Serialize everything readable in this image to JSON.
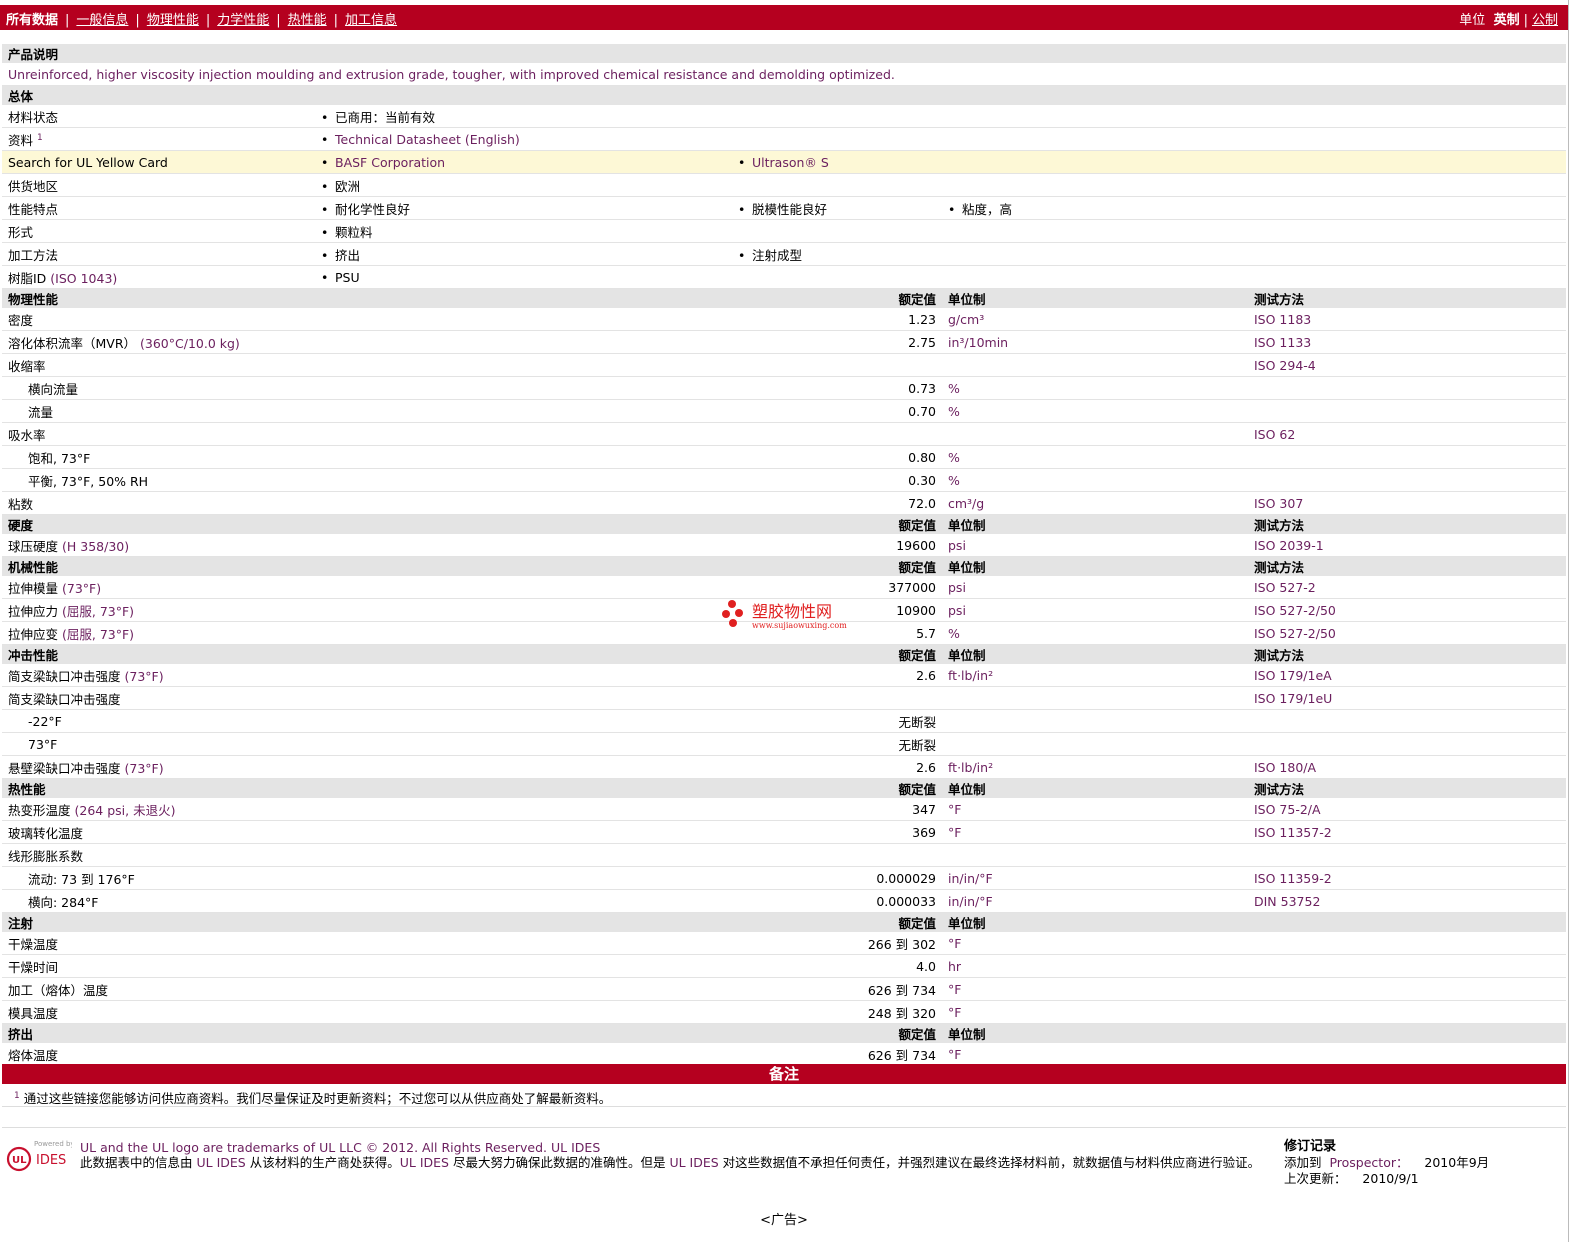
{
  "topbar": {
    "tabs": [
      {
        "label": "所有数据",
        "active": true
      },
      {
        "label": "一般信息"
      },
      {
        "label": "物理性能"
      },
      {
        "label": "力学性能"
      },
      {
        "label": "热性能"
      },
      {
        "label": "加工信息"
      }
    ],
    "units_label": "单位",
    "units_active": "英制",
    "units_other": "公制"
  },
  "description": {
    "title": "产品说明",
    "text": "Unreinforced, higher viscosity injection moulding and extrusion grade, tougher, with improved chemical resistance and demolding optimized."
  },
  "general": {
    "title": "总体",
    "rows": [
      {
        "label": "材料状态",
        "values": [
          "已商用：当前有效"
        ]
      },
      {
        "label": "资料",
        "sup": "1",
        "values": [
          "Technical Datasheet (English)"
        ],
        "link": true
      },
      {
        "label": "Search for UL Yellow Card",
        "values": [
          "BASF Corporation",
          "Ultrason® S"
        ],
        "link": true,
        "highlight": true
      },
      {
        "label": "供货地区",
        "values": [
          "欧洲"
        ]
      },
      {
        "label": "性能特点",
        "values": [
          "耐化学性良好",
          "脱模性能良好",
          "粘度，高"
        ]
      },
      {
        "label": "形式",
        "values": [
          "颗粒料"
        ]
      },
      {
        "label": "加工方法",
        "values": [
          "挤出",
          "注射成型"
        ]
      },
      {
        "label": "树脂ID",
        "label_extra": "(ISO 1043)",
        "values": [
          "PSU"
        ]
      }
    ]
  },
  "headers": {
    "value": "额定值",
    "unit": "单位制",
    "method": "测试方法"
  },
  "sections": [
    {
      "title": "物理性能",
      "show_method": true,
      "rows": [
        {
          "label": "密度",
          "value": "1.23",
          "unit": "g/cm³",
          "method": "ISO 1183"
        },
        {
          "label": "溶化体积流率（MVR）",
          "extra": "(360°C/10.0 kg)",
          "value": "2.75",
          "unit": "in³/10min",
          "method": "ISO 1133"
        },
        {
          "label": "收缩率",
          "value": "",
          "unit": "",
          "method": "ISO 294-4"
        },
        {
          "label": "横向流量",
          "sub": true,
          "value": "0.73",
          "unit": "%",
          "method": ""
        },
        {
          "label": "流量",
          "sub": true,
          "value": "0.70",
          "unit": "%",
          "method": ""
        },
        {
          "label": "吸水率",
          "value": "",
          "unit": "",
          "method": "ISO 62"
        },
        {
          "label": "饱和, 73°F",
          "sub": true,
          "value": "0.80",
          "unit": "%",
          "method": ""
        },
        {
          "label": "平衡, 73°F, 50% RH",
          "sub": true,
          "value": "0.30",
          "unit": "%",
          "method": ""
        },
        {
          "label": "粘数",
          "value": "72.0",
          "unit": "cm³/g",
          "method": "ISO 307"
        }
      ]
    },
    {
      "title": "硬度",
      "show_method": true,
      "rows": [
        {
          "label": "球压硬度",
          "extra": "(H 358/30)",
          "value": "19600",
          "unit": "psi",
          "method": "ISO 2039-1"
        }
      ]
    },
    {
      "title": "机械性能",
      "show_method": true,
      "rows": [
        {
          "label": "拉伸模量",
          "extra": "(73°F)",
          "value": "377000",
          "unit": "psi",
          "method": "ISO 527-2"
        },
        {
          "label": "拉伸应力",
          "extra": "(屈服, 73°F)",
          "value": "10900",
          "unit": "psi",
          "method": "ISO 527-2/50"
        },
        {
          "label": "拉伸应变",
          "extra": "(屈服, 73°F)",
          "value": "5.7",
          "unit": "%",
          "method": "ISO 527-2/50"
        }
      ]
    },
    {
      "title": "冲击性能",
      "show_method": true,
      "rows": [
        {
          "label": "简支梁缺口冲击强度",
          "extra": "(73°F)",
          "value": "2.6",
          "unit": "ft·lb/in²",
          "method": "ISO 179/1eA"
        },
        {
          "label": "简支梁缺口冲击强度",
          "value": "",
          "unit": "",
          "method": "ISO 179/1eU"
        },
        {
          "label": "-22°F",
          "sub": true,
          "value": "无断裂",
          "unit": "",
          "method": ""
        },
        {
          "label": "73°F",
          "sub": true,
          "value": "无断裂",
          "unit": "",
          "method": ""
        },
        {
          "label": "悬壁梁缺口冲击强度",
          "extra": "(73°F)",
          "value": "2.6",
          "unit": "ft·lb/in²",
          "method": "ISO 180/A"
        }
      ]
    },
    {
      "title": "热性能",
      "show_method": true,
      "rows": [
        {
          "label": "热变形温度",
          "extra": "(264 psi, 未退火)",
          "value": "347",
          "unit": "°F",
          "method": "ISO 75-2/A"
        },
        {
          "label": "玻璃转化温度",
          "value": "369",
          "unit": "°F",
          "method": "ISO 11357-2"
        },
        {
          "label": "线形膨胀系数",
          "value": "",
          "unit": "",
          "method": ""
        },
        {
          "label": "流动: 73 到 176°F",
          "sub": true,
          "value": "0.000029",
          "unit": "in/in/°F",
          "method": "ISO 11359-2"
        },
        {
          "label": "横向: 284°F",
          "sub": true,
          "value": "0.000033",
          "unit": "in/in/°F",
          "method": "DIN 53752"
        }
      ]
    },
    {
      "title": "注射",
      "show_method": false,
      "rows": [
        {
          "label": "干燥温度",
          "value": "266 到  302",
          "unit": "°F",
          "method": ""
        },
        {
          "label": "干燥时间",
          "value": "4.0",
          "unit": "hr",
          "method": ""
        },
        {
          "label": "加工（熔体）温度",
          "value": "626 到  734",
          "unit": "°F",
          "method": ""
        },
        {
          "label": "模具温度",
          "value": "248 到  320",
          "unit": "°F",
          "method": ""
        }
      ]
    },
    {
      "title": "挤出",
      "show_method": false,
      "rows": [
        {
          "label": "熔体温度",
          "value": "626 到  734",
          "unit": "°F",
          "method": ""
        }
      ]
    }
  ],
  "notes": {
    "title": "备注",
    "footnote_num": "1",
    "footnote": "通过这些链接您能够访问供应商资料。我们尽量保证及时更新资料；不过您可以从供应商处了解最新资料。"
  },
  "footer": {
    "logo_powered": "Powered by",
    "logo_ul": "UL",
    "logo_ides": "IDES",
    "legal_line1": "UL and the UL logo are trademarks of UL LLC © 2012. All Rights Reserved.",
    "legal_line1_link": "UL IDES",
    "legal_line2a": "此数据表中的信息由",
    "legal_link_a": "UL IDES",
    "legal_line2b": "从该材料的生产商处获得。",
    "legal_link_b": "UL IDES",
    "legal_line2c": "尽最大努力确保此数据的准确性。但是",
    "legal_link_c": "UL IDES",
    "legal_line2d": "对这些数据值不承担任何责任，并强烈建议在最终选择材料前，就数据值与材料供应商进行验证。",
    "revision_title": "修订记录",
    "added_label": "添加到",
    "added_link": "Prospector：",
    "added_date": "2010年9月",
    "updated_label": "上次更新：",
    "updated_date": "2010/9/1",
    "ad": "<广告>"
  },
  "watermark": {
    "text": "塑胶物性网",
    "url": "www.sujiaowuxing.com",
    "color": "#e02020"
  }
}
